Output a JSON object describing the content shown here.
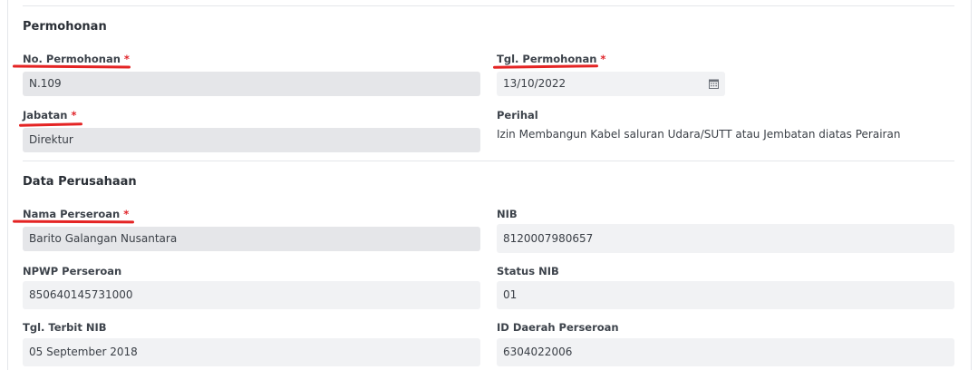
{
  "permohonan": {
    "section_title": "Permohonan",
    "no_permohonan": {
      "label": "No. Permohonan",
      "required_mark": "*",
      "value": "N.109"
    },
    "tgl_permohonan": {
      "label": "Tgl. Permohonan",
      "required_mark": "*",
      "value": "13/10/2022",
      "icon": "calendar-icon"
    },
    "jabatan": {
      "label": "Jabatan",
      "required_mark": "*",
      "value": "Direktur"
    },
    "perihal": {
      "label": "Perihal",
      "value": "Izin Membangun Kabel saluran Udara/SUTT atau Jembatan diatas Perairan"
    }
  },
  "data_perusahaan": {
    "section_title": "Data Perusahaan",
    "nama_perseroan": {
      "label": "Nama Perseroan",
      "required_mark": "*",
      "value": "Barito Galangan Nusantara"
    },
    "nib": {
      "label": "NIB",
      "value": "8120007980657"
    },
    "npwp_perseroan": {
      "label": "NPWP Perseroan",
      "value": "850640145731000"
    },
    "status_nib": {
      "label": "Status NIB",
      "value": "01"
    },
    "tgl_terbit_nib": {
      "label": "Tgl. Terbit NIB",
      "value": "05 September 2018"
    },
    "id_daerah_perseroan": {
      "label": "ID Daerah Perseroan",
      "value": "6304022006"
    }
  },
  "colors": {
    "annotation_underline": "#e42424",
    "required_asterisk": "#e0242a",
    "disabled_field": "#e5e6e9",
    "readonly_field": "#f1f2f4"
  }
}
